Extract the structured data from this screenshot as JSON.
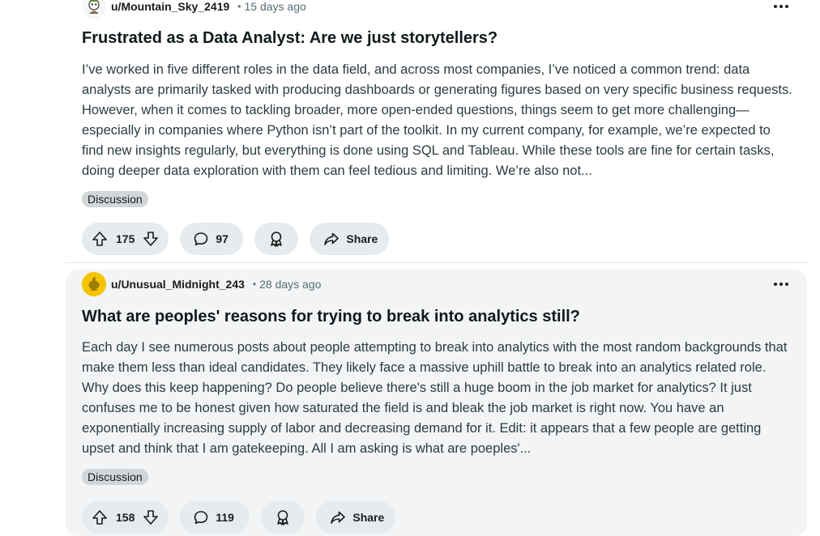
{
  "posts": [
    {
      "username": "u/Mountain_Sky_2419",
      "separator": "•",
      "time": "15 days ago",
      "title": "Frustrated as a Data Analyst: Are we just storytellers?",
      "body": "I’ve worked in five different roles in the data field, and across most companies, I’ve noticed a common trend: data analysts are primarily tasked with producing dashboards or generating figures based on very specific business requests. However, when it comes to tackling broader, more open-ended questions, things seem to get more challenging—especially in companies where Python isn’t part of the toolkit. In my current company, for example, we’re expected to find new insights regularly, but everything is done using SQL and Tableau. While these tools are fine for certain tasks, doing deeper data exploration with them can feel tedious and limiting. We’re also not...",
      "flair": "Discussion",
      "votes": "175",
      "comments": "97",
      "share_label": "Share"
    },
    {
      "username": "u/Unusual_Midnight_243",
      "separator": "•",
      "time": "28 days ago",
      "title": "What are peoples' reasons for trying to break into analytics still?",
      "body": "Each day I see numerous posts about people attempting to break into analytics with the most random backgrounds that make them less than ideal candidates. They likely face a massive uphill battle to break into an analytics related role. Why does this keep happening? Do people believe there's still a huge boom in the job market for analytics? It just confuses me to be honest given how saturated the field is and bleak the job market is right now. You have an exponentially increasing supply of labor and decreasing demand for it. Edit: it appears that a few people are getting upset and think that I am gatekeeping. All I am asking is what are poeples'...",
      "flair": "Discussion",
      "votes": "158",
      "comments": "119",
      "share_label": "Share"
    }
  ],
  "icons": {
    "upvote": "upvote-icon",
    "downvote": "downvote-icon",
    "comment": "comment-icon",
    "award": "award-icon",
    "share": "share-icon",
    "more": "more-options-icon"
  }
}
